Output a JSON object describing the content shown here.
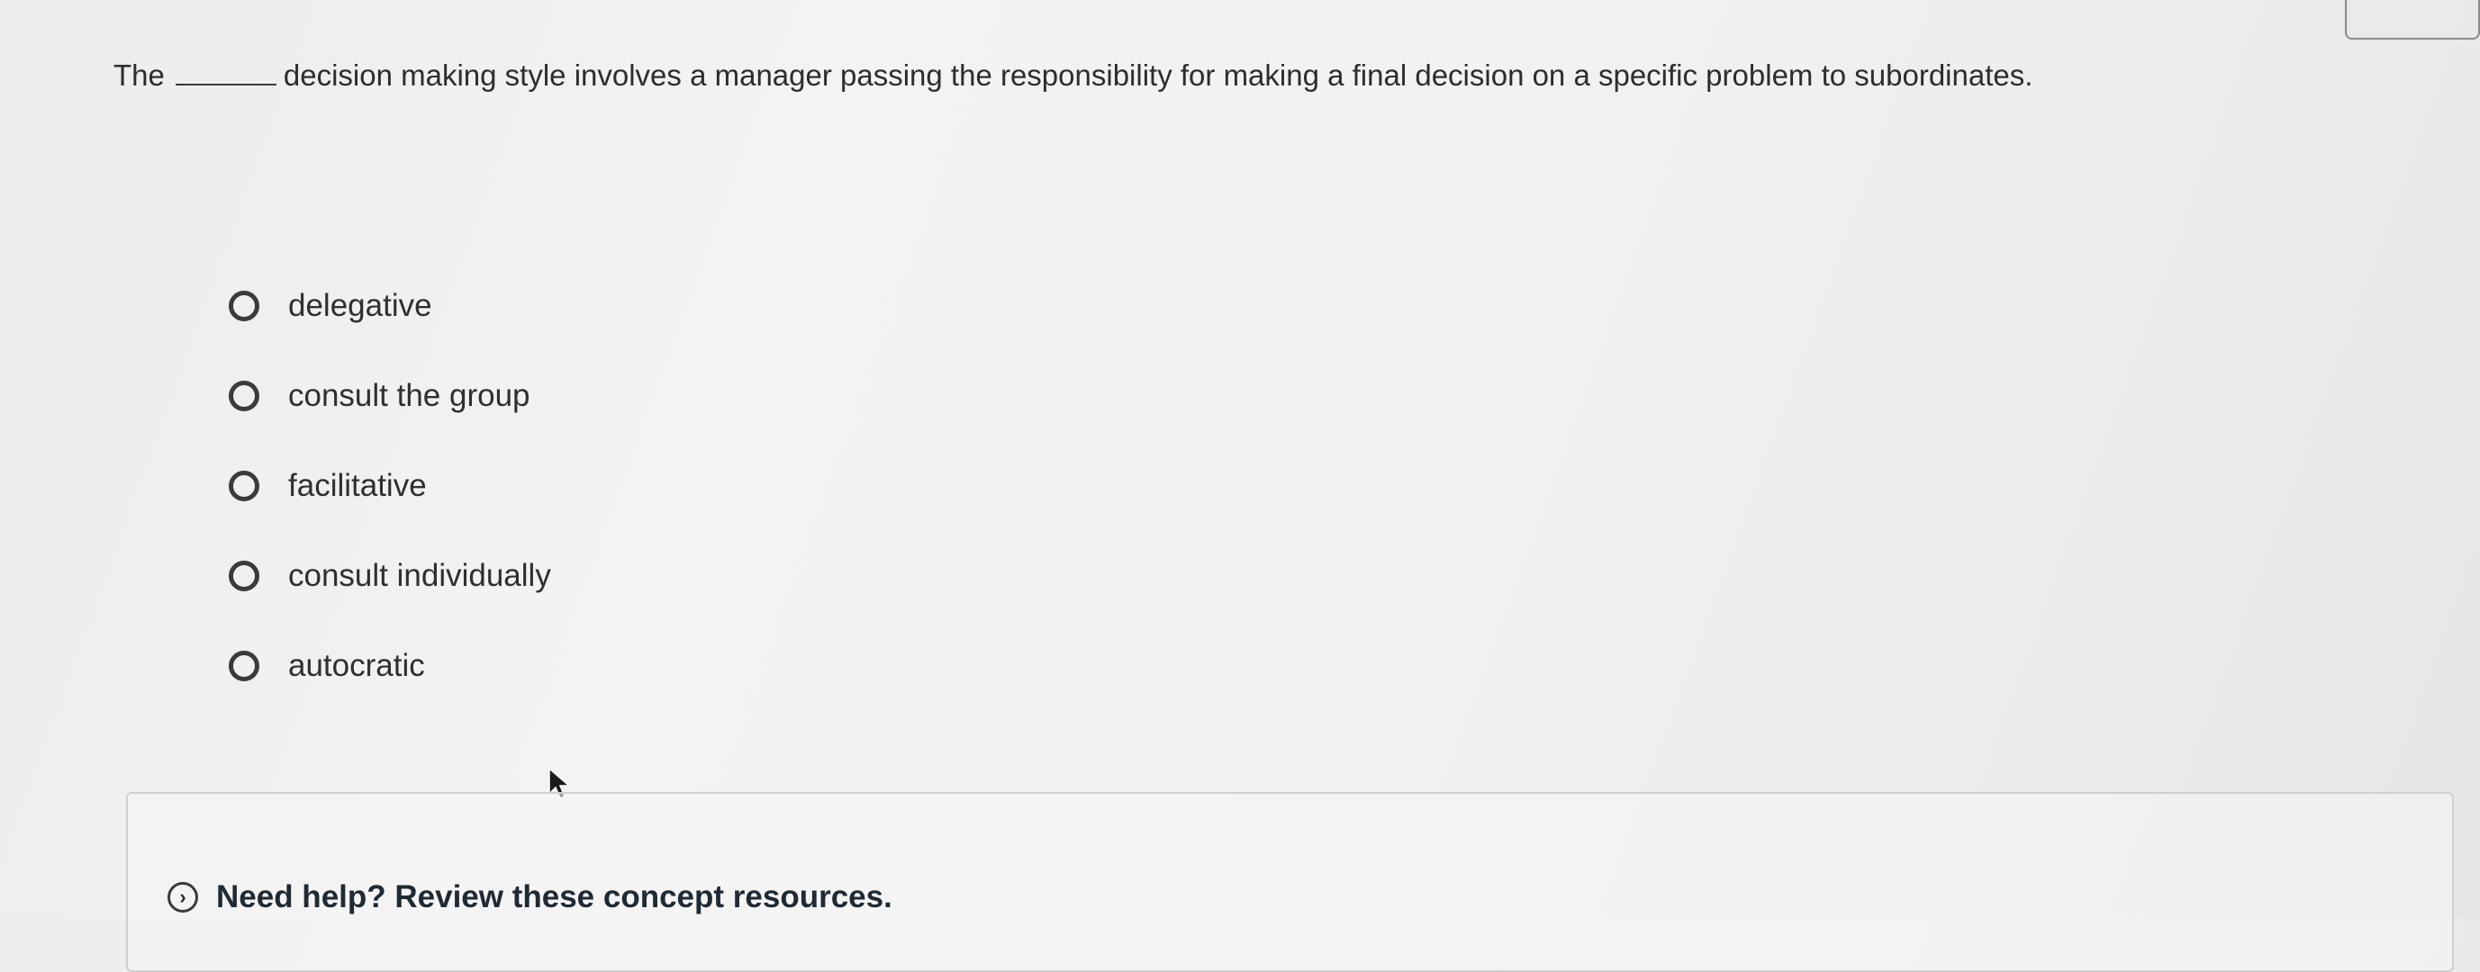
{
  "question": {
    "prefix": "The",
    "suffix": "decision making style involves a manager passing the responsibility for making a final decision on a specific problem to subordinates."
  },
  "options": [
    {
      "label": "delegative",
      "selected": false
    },
    {
      "label": "consult the group",
      "selected": false
    },
    {
      "label": "facilitative",
      "selected": false
    },
    {
      "label": "consult individually",
      "selected": false
    },
    {
      "label": "autocratic",
      "selected": false
    }
  ],
  "help": {
    "label": "Need help? Review these concept resources.",
    "icon": "chevron-right-circle-icon"
  },
  "cursor": {
    "icon": "mouse-pointer-icon"
  },
  "colors": {
    "text": "#2d2d2d",
    "radio_border": "#3a3a3a",
    "help_text": "#1f2a33"
  }
}
